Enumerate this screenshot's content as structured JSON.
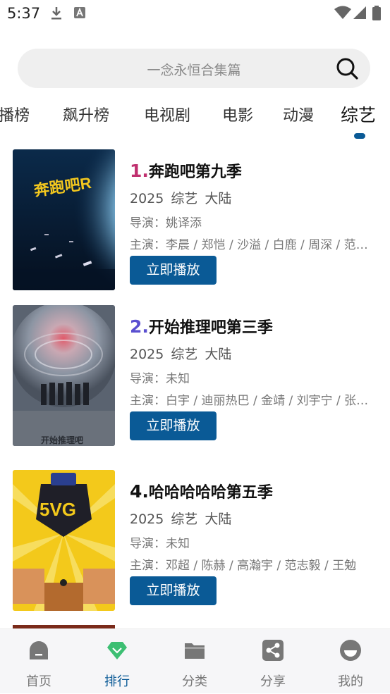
{
  "status": {
    "time": "5:37"
  },
  "search": {
    "placeholder": "一念永恒合集篇"
  },
  "tabs": [
    {
      "label": "播榜"
    },
    {
      "label": "飙升榜"
    },
    {
      "label": "电视剧"
    },
    {
      "label": "电影"
    },
    {
      "label": "动漫"
    },
    {
      "label": "综艺"
    }
  ],
  "items": [
    {
      "rank": "1.",
      "rank_color": "#c0306f",
      "title": "奔跑吧第九季",
      "year": "2025",
      "genre": "综艺",
      "region": "大陆",
      "director": "导演：姚译添",
      "cast": "主演：李晨 / 郑恺 / 沙溢 / 白鹿 / 周深 / 范丞丞",
      "play_label": "立即播放"
    },
    {
      "rank": "2.",
      "rank_color": "#5a4fd0",
      "title": "开始推理吧第三季",
      "year": "2025",
      "genre": "综艺",
      "region": "大陆",
      "director": "导演：未知",
      "cast": "主演：白宇 / 迪丽热巴 / 金靖 / 刘宇宁 / 张若昀",
      "play_label": "立即播放",
      "poster_text": "开始推理吧"
    },
    {
      "rank": "4.",
      "rank_color": "#111111",
      "title": "哈哈哈哈哈第五季",
      "year": "2025",
      "genre": "综艺",
      "region": "大陆",
      "director": "导演：未知",
      "cast": "主演：邓超 / 陈赫 / 高瀚宇 / 范志毅 / 王勉",
      "play_label": "立即播放"
    }
  ],
  "nav": [
    {
      "label": "首页",
      "icon": "home-icon"
    },
    {
      "label": "排行",
      "icon": "rank-gem-icon"
    },
    {
      "label": "分类",
      "icon": "folder-icon"
    },
    {
      "label": "分享",
      "icon": "share-icon"
    },
    {
      "label": "我的",
      "icon": "profile-icon"
    }
  ],
  "colors": {
    "accent": "#0a5a96",
    "active_gem": "#3dbf73"
  }
}
